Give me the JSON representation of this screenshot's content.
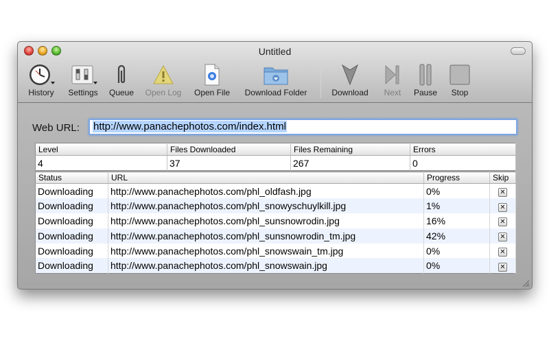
{
  "window": {
    "title": "Untitled"
  },
  "toolbar": {
    "history": "History",
    "settings": "Settings",
    "queue": "Queue",
    "open_log": "Open Log",
    "open_file": "Open File",
    "download_folder": "Download Folder",
    "download": "Download",
    "next": "Next",
    "pause": "Pause",
    "stop": "Stop"
  },
  "url": {
    "label": "Web URL:",
    "value": "http://www.panachephotos.com/index.html"
  },
  "stats": {
    "headers": [
      "Level",
      "Files Downloaded",
      "Files Remaining",
      "Errors"
    ],
    "values": [
      "4",
      "37",
      "267",
      "0"
    ]
  },
  "downloads": {
    "headers": {
      "status": "Status",
      "url": "URL",
      "progress": "Progress",
      "skip": "Skip"
    },
    "skip_glyph": "✕",
    "rows": [
      {
        "status": "Downloading",
        "url": "http://www.panachephotos.com/phl_oldfash.jpg",
        "progress": "0%"
      },
      {
        "status": "Downloading",
        "url": "http://www.panachephotos.com/phl_snowyschuylkill.jpg",
        "progress": "1%"
      },
      {
        "status": "Downloading",
        "url": "http://www.panachephotos.com/phl_sunsnowrodin.jpg",
        "progress": "16%"
      },
      {
        "status": "Downloading",
        "url": "http://www.panachephotos.com/phl_sunsnowrodin_tm.jpg",
        "progress": "42%"
      },
      {
        "status": "Downloading",
        "url": "http://www.panachephotos.com/phl_snowswain_tm.jpg",
        "progress": "0%"
      },
      {
        "status": "Downloading",
        "url": "http://www.panachephotos.com/phl_snowswain.jpg",
        "progress": "0%"
      }
    ]
  }
}
